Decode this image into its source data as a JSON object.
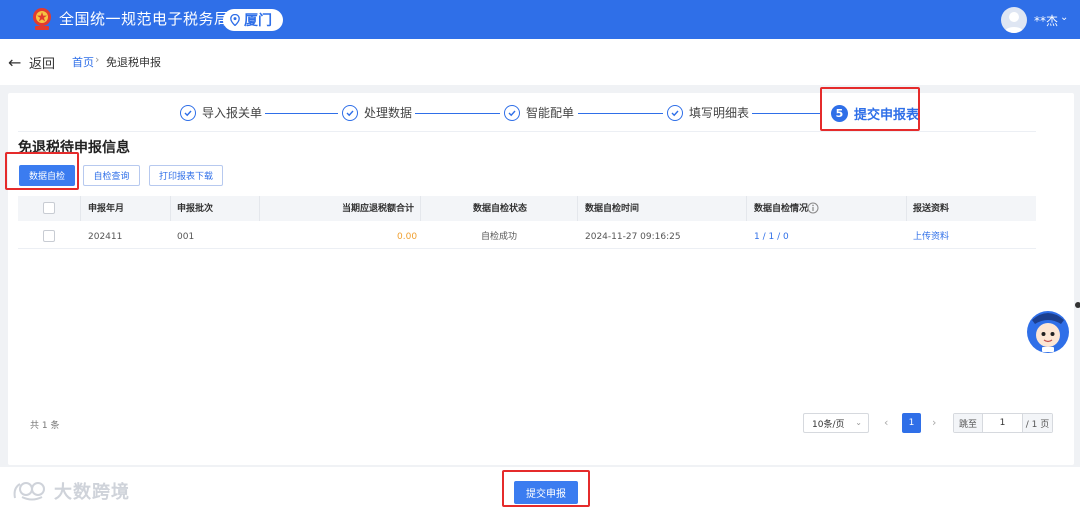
{
  "header": {
    "title": "全国统一规范电子税务局",
    "region": "厦门",
    "user": "**杰"
  },
  "nav": {
    "back": "返回",
    "breadcrumb": [
      "首页",
      "免退税申报"
    ],
    "separator": "›"
  },
  "stepper": {
    "steps": [
      "导入报关单",
      "处理数据",
      "智能配单",
      "填写明细表"
    ],
    "active_number": "5",
    "active_label": "提交申报表"
  },
  "section_title": "免退税待申报信息",
  "toolbar": {
    "self_check": "数据自检",
    "check_query": "自检查询",
    "print_download": "打印报表下载"
  },
  "table": {
    "headers": [
      "申报年月",
      "申报批次",
      "当期应退税额合计",
      "数据自检状态",
      "数据自检时间",
      "数据自检情况",
      "报送资料"
    ],
    "rows": [
      {
        "period": "202411",
        "batch": "001",
        "amount": "0.00",
        "status": "自检成功",
        "time": "2024-11-27 09:16:25",
        "result": "1 / 1 / 0",
        "upload": "上传资料"
      }
    ]
  },
  "pagination": {
    "total": "共 1 条",
    "page_size": "10条/页",
    "current_page": "1",
    "jump_label": "跳至",
    "jump_value": "1",
    "total_pages": "/ 1 页"
  },
  "footer": {
    "submit": "提交申报",
    "watermark": "大数跨境"
  },
  "colors": {
    "brand": "#2f6fe8",
    "highlight": "#e52b2b",
    "amount": "#f0a030"
  }
}
